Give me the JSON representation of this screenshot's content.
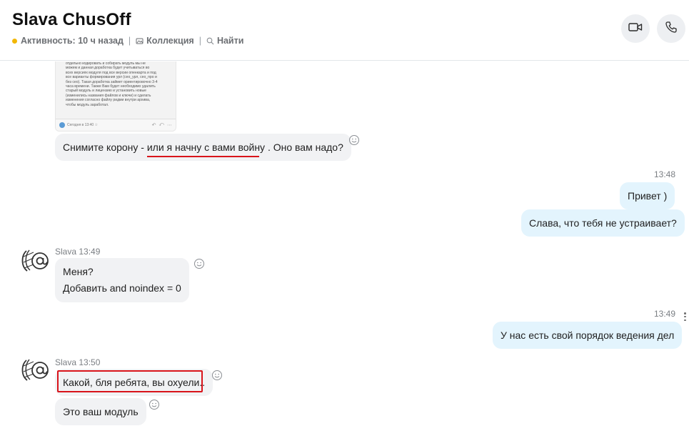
{
  "header": {
    "title": "Slava ChusOff",
    "activity": "Активность: 10 ч назад",
    "separator": "|",
    "collection": "Коллекция",
    "search": "Найти",
    "video_icon": "video-camera-icon",
    "call_icon": "phone-icon",
    "status_color": "#f2b705"
  },
  "thumbnail": {
    "lines": [
      "отдельно кодировать и собирать модуль мы не",
      "можем и данная доработка будет учитываться во",
      "всех версиях модуля под все версии опенкарта и под",
      "все варианты формирования урл (сео_урл, сео_про и",
      "без сео). Такая доработка займет ориентировочно 3-4",
      "часа времени. Также Вам будет необходимо удалить",
      "старый модуль и лицензию и установить новые",
      "(изменились названия файлов и ключи) и сделать",
      "изменения согласно файлу ридми внутри архива,",
      "чтобы модуль заработал."
    ],
    "footer": "Сегодня в 13:40 ☆"
  },
  "messages": [
    {
      "id": "m1",
      "text": "Снимите корону - или я начну с вами войну . Оно вам надо?"
    },
    {
      "id": "m2",
      "time": "13:48",
      "text": "Привет )"
    },
    {
      "id": "m3",
      "text": "Слава, что тебя не устраивает?"
    },
    {
      "id": "m4",
      "sender_time": "Slava 13:49",
      "lines": [
        "Меня?",
        "Добавить and noindex = 0"
      ]
    },
    {
      "id": "m5",
      "time": "13:49",
      "text": "У нас есть свой порядок ведения дел"
    },
    {
      "id": "m6",
      "sender_time": "Slava 13:50",
      "text": "Какой, бля ребята, вы охуели.."
    },
    {
      "id": "m7",
      "text": "Это ваш модуль"
    }
  ],
  "colors": {
    "incoming_bubble": "#f1f2f4",
    "outgoing_bubble": "#e3f4fd",
    "highlight_red": "#d9141b"
  },
  "icons": {
    "reaction": "smiley-icon",
    "avatar": "avatar-logo-icon",
    "more": "more-vertical-icon"
  }
}
